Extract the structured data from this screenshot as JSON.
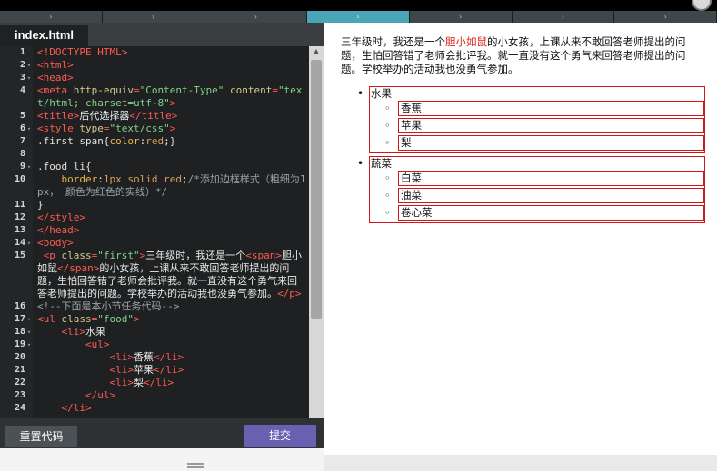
{
  "steps": {
    "count": 7,
    "active_index": 3,
    "chevron_glyph": "›"
  },
  "editor": {
    "tab_label": "index.html",
    "lines": [
      {
        "n": "1",
        "fold": "",
        "tokens": [
          [
            "tag",
            "<!DOCTYPE HTML>"
          ]
        ]
      },
      {
        "n": "2",
        "fold": "▾",
        "tokens": [
          [
            "tag",
            "<html>"
          ]
        ]
      },
      {
        "n": "3",
        "fold": "▾",
        "tokens": [
          [
            "tag",
            "<head>"
          ]
        ]
      },
      {
        "n": "4",
        "fold": "",
        "tokens": [
          [
            "tag",
            "<meta "
          ],
          [
            "attr",
            "http-equiv"
          ],
          [
            "tag",
            "="
          ],
          [
            "str",
            "\"Content-Type\""
          ],
          [
            "tag",
            " "
          ],
          [
            "attr",
            "content"
          ],
          [
            "tag",
            "="
          ],
          [
            "str",
            "\"text/html; charset=utf-8\""
          ],
          [
            "tag",
            ">"
          ]
        ]
      },
      {
        "n": "5",
        "fold": "",
        "tokens": [
          [
            "tag",
            "<title>"
          ],
          [
            "text",
            "后代选择器"
          ],
          [
            "tag",
            "</title>"
          ]
        ]
      },
      {
        "n": "6",
        "fold": "▾",
        "tokens": [
          [
            "tag",
            "<style "
          ],
          [
            "attr",
            "type"
          ],
          [
            "tag",
            "="
          ],
          [
            "str",
            "\"text/css\""
          ],
          [
            "tag",
            ">"
          ]
        ]
      },
      {
        "n": "7",
        "fold": "",
        "tokens": [
          [
            "sel",
            ".first span"
          ],
          [
            "sel",
            "{"
          ],
          [
            "prop",
            "color"
          ],
          [
            "sel",
            ":"
          ],
          [
            "kw",
            "red"
          ],
          [
            "sel",
            ";}"
          ]
        ]
      },
      {
        "n": "8",
        "fold": "",
        "tokens": [
          [
            "text",
            " "
          ]
        ]
      },
      {
        "n": "9",
        "fold": "▾",
        "tokens": [
          [
            "sel",
            ".food li{"
          ]
        ]
      },
      {
        "n": "10",
        "fold": "",
        "tokens": [
          [
            "sel",
            "    "
          ],
          [
            "prop",
            "border"
          ],
          [
            "sel",
            ":"
          ],
          [
            "kw",
            "1px solid red"
          ],
          [
            "sel",
            ";"
          ],
          [
            "cmt",
            "/*添加边框样式（粗细为1px， 颜色为红色的实线）*/"
          ]
        ]
      },
      {
        "n": "11",
        "fold": "",
        "tokens": [
          [
            "sel",
            "}"
          ]
        ]
      },
      {
        "n": "12",
        "fold": "",
        "tokens": [
          [
            "tag",
            "</style>"
          ]
        ]
      },
      {
        "n": "13",
        "fold": "",
        "tokens": [
          [
            "tag",
            "</head>"
          ]
        ]
      },
      {
        "n": "14",
        "fold": "▾",
        "tokens": [
          [
            "tag",
            "<body>"
          ]
        ]
      },
      {
        "n": "15",
        "fold": "",
        "tokens": [
          [
            "tag",
            " <p "
          ],
          [
            "attr",
            "class"
          ],
          [
            "tag",
            "="
          ],
          [
            "str",
            "\"first\""
          ],
          [
            "tag",
            ">"
          ],
          [
            "text",
            "三年级时，我还是一个"
          ],
          [
            "tag",
            "<span>"
          ],
          [
            "text",
            "胆小如鼠"
          ],
          [
            "tag",
            "</span>"
          ],
          [
            "text",
            "的小女孩，上课从来不敢回答老师提出的问题，生怕回答错了老师会批评我。就一直没有这个勇气来回答老师提出的问题。学校举办的活动我也没勇气参加。"
          ],
          [
            "tag",
            "</p>"
          ]
        ]
      },
      {
        "n": "16",
        "fold": "",
        "tokens": [
          [
            "cmt",
            "<!--下面是本小节任务代码-->"
          ]
        ]
      },
      {
        "n": "17",
        "fold": "▾",
        "tokens": [
          [
            "tag",
            "<ul "
          ],
          [
            "attr",
            "class"
          ],
          [
            "tag",
            "="
          ],
          [
            "str",
            "\"food\""
          ],
          [
            "tag",
            ">"
          ]
        ]
      },
      {
        "n": "18",
        "fold": "▾",
        "tokens": [
          [
            "tag",
            "    <li>"
          ],
          [
            "text",
            "水果"
          ]
        ]
      },
      {
        "n": "19",
        "fold": "▾",
        "tokens": [
          [
            "tag",
            "        <ul>"
          ]
        ]
      },
      {
        "n": "20",
        "fold": "",
        "tokens": [
          [
            "tag",
            "            <li>"
          ],
          [
            "text",
            "香蕉"
          ],
          [
            "tag",
            "</li>"
          ]
        ]
      },
      {
        "n": "21",
        "fold": "",
        "tokens": [
          [
            "tag",
            "            <li>"
          ],
          [
            "text",
            "苹果"
          ],
          [
            "tag",
            "</li>"
          ]
        ]
      },
      {
        "n": "22",
        "fold": "",
        "tokens": [
          [
            "tag",
            "            <li>"
          ],
          [
            "text",
            "梨"
          ],
          [
            "tag",
            "</li>"
          ]
        ]
      },
      {
        "n": "23",
        "fold": "",
        "tokens": [
          [
            "tag",
            "        </ul>"
          ]
        ]
      },
      {
        "n": "24",
        "fold": "",
        "tokens": [
          [
            "tag",
            "    </li>"
          ]
        ]
      }
    ]
  },
  "buttons": {
    "reset_label": "重置代码",
    "submit_label": "提交"
  },
  "preview": {
    "para_before": "三年级时，我还是一个",
    "para_span": "胆小如鼠",
    "para_after": "的小女孩，上课从来不敢回答老师提出的问题，生怕回答错了老师会批评我。就一直没有这个勇气来回答老师提出的问题。学校举办的活动我也没勇气参加。",
    "food": [
      {
        "label": "水果",
        "items": [
          "香蕉",
          "苹果",
          "梨"
        ]
      },
      {
        "label": "蔬菜",
        "items": [
          "白菜",
          "油菜",
          "卷心菜"
        ]
      }
    ]
  }
}
